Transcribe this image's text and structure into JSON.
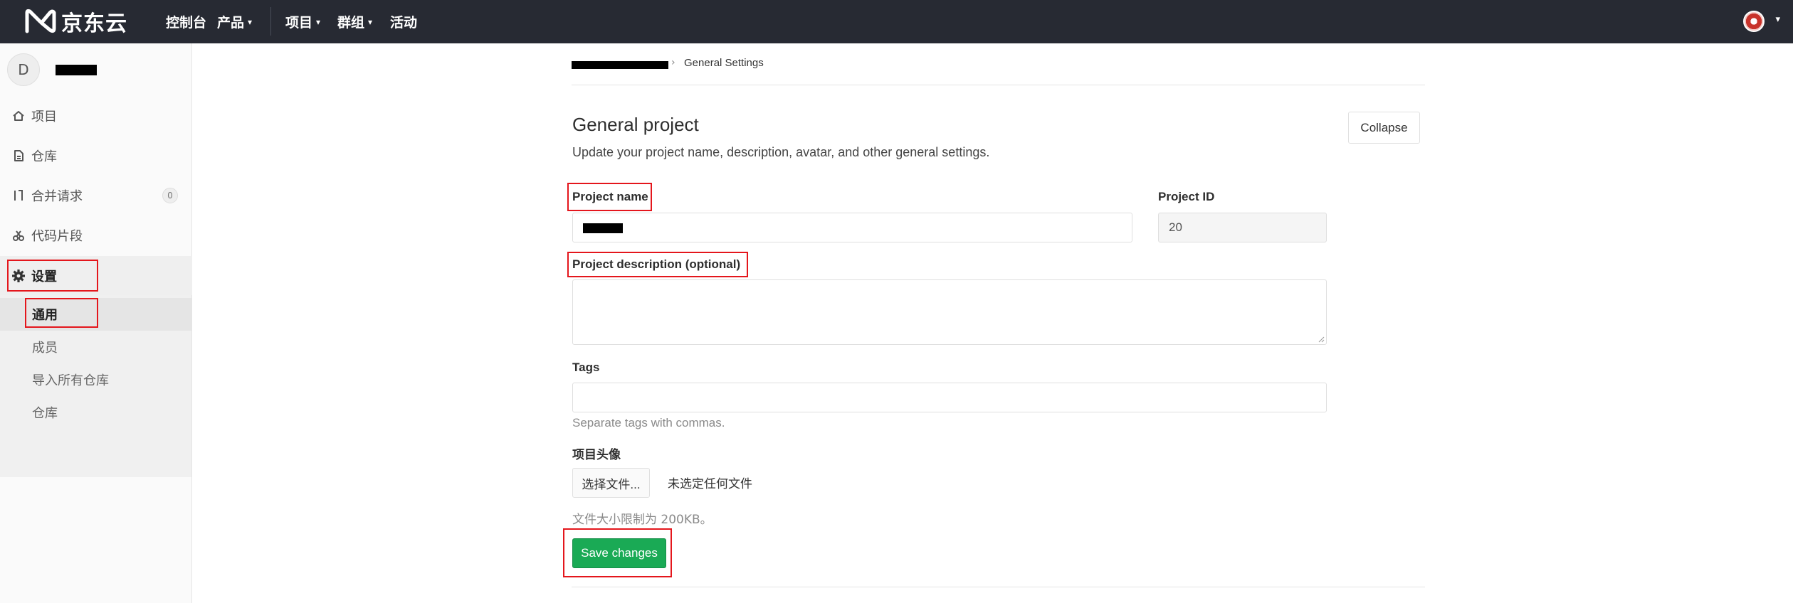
{
  "topbar": {
    "logo_text": "京东云",
    "nav": [
      {
        "label": "控制台"
      },
      {
        "label": "产品"
      },
      {
        "label": "项目"
      },
      {
        "label": "群组"
      },
      {
        "label": "活动"
      }
    ],
    "chevron": "⌄"
  },
  "sidebar": {
    "project_initial": "D",
    "items": [
      {
        "label": "项目",
        "icon": "home-icon"
      },
      {
        "label": "仓库",
        "icon": "file-icon"
      },
      {
        "label": "合并请求",
        "icon": "merge-request-icon",
        "badge": "0"
      },
      {
        "label": "代码片段",
        "icon": "scissors-icon"
      },
      {
        "label": "设置",
        "icon": "gear-icon"
      }
    ],
    "sub_items": [
      {
        "label": "通用"
      },
      {
        "label": "成员"
      },
      {
        "label": "导入所有仓库"
      },
      {
        "label": "仓库"
      }
    ]
  },
  "breadcrumb": {
    "separator": "›",
    "current": "General Settings"
  },
  "section": {
    "title": "General project",
    "description": "Update your project name, description, avatar, and other general settings.",
    "collapse_label": "Collapse"
  },
  "form": {
    "project_name_label": "Project name",
    "project_id_label": "Project ID",
    "project_id_value": "20",
    "description_label": "Project description (optional)",
    "description_value": "",
    "tags_label": "Tags",
    "tags_value": "",
    "tags_help": "Separate tags with commas.",
    "avatar_label": "项目头像",
    "file_button_label": "选择文件...",
    "file_none_label": "未选定任何文件",
    "file_size_help": "文件大小限制为 200KB。",
    "save_label": "Save changes"
  },
  "colors": {
    "topbar_bg": "#272a33",
    "save_green": "#1aaa55",
    "highlight_red": "#e4161c"
  }
}
